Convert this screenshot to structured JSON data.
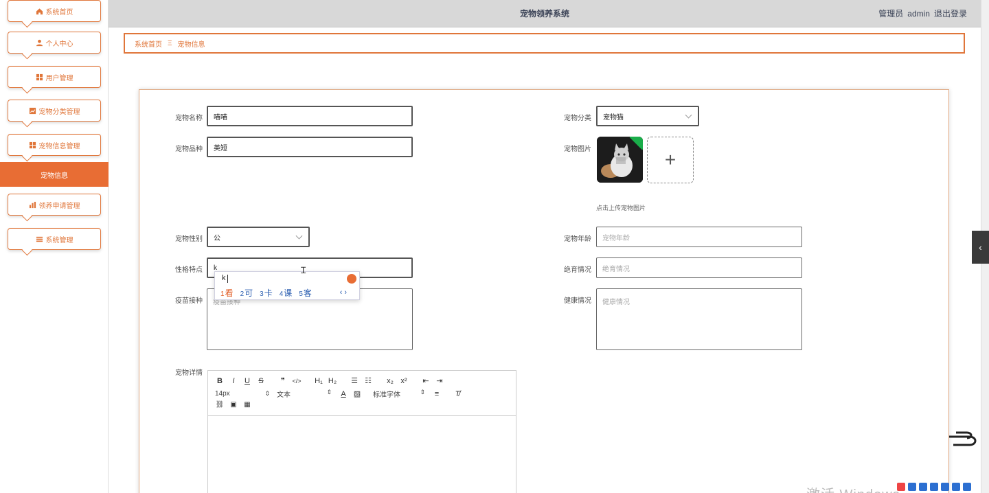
{
  "header": {
    "title": "宠物领养系统",
    "user_role": "管理员",
    "user_name": "admin",
    "logout": "退出登录"
  },
  "sidebar": {
    "items": [
      {
        "label": "系统首页",
        "icon": "home-icon"
      },
      {
        "label": "个人中心",
        "icon": "user-icon"
      },
      {
        "label": "用户管理",
        "icon": "grid-icon"
      },
      {
        "label": "宠物分类管理",
        "icon": "chart-icon"
      },
      {
        "label": "宠物信息管理",
        "icon": "grid-icon"
      },
      {
        "label": "领养申请管理",
        "icon": "bar-chart-icon"
      },
      {
        "label": "系统管理",
        "icon": "list-icon"
      }
    ],
    "active_sub": "宠物信息"
  },
  "breadcrumb": {
    "home": "系统首页",
    "sep": "Ξ",
    "current": "宠物信息"
  },
  "form": {
    "pet_name": {
      "label": "宠物名称",
      "value": "喵喵"
    },
    "pet_category": {
      "label": "宠物分类",
      "value": "宠物猫"
    },
    "pet_breed": {
      "label": "宠物品种",
      "value": "英短"
    },
    "pet_image": {
      "label": "宠物图片",
      "hint": "点击上传宠物图片",
      "add": "+"
    },
    "pet_gender": {
      "label": "宠物性别",
      "value": "公"
    },
    "pet_age": {
      "label": "宠物年龄",
      "placeholder": "宠物年龄"
    },
    "personality": {
      "label": "性格特点",
      "value": "k"
    },
    "sterilization": {
      "label": "绝育情况",
      "placeholder": "绝育情况"
    },
    "vaccine": {
      "label": "疫苗接种",
      "placeholder": "疫苗接种"
    },
    "health": {
      "label": "健康情况",
      "placeholder": "健康情况"
    },
    "details": {
      "label": "宠物详情"
    }
  },
  "editor": {
    "row1": [
      "B",
      "I",
      "U",
      "S",
      "❞",
      "</>",
      "H₁",
      "H₂",
      "☰",
      "☷",
      "x₂",
      "x²",
      "⇤",
      "⇥"
    ],
    "font_size": "14px",
    "text_type": "文本",
    "font_family": "标准字体",
    "row3": [
      "🔗",
      "🖼",
      "🎞"
    ]
  },
  "ime": {
    "input": "k",
    "candidates": [
      {
        "n": "1",
        "w": "看"
      },
      {
        "n": "2",
        "w": "可"
      },
      {
        "n": "3",
        "w": "卡"
      },
      {
        "n": "4",
        "w": "课"
      },
      {
        "n": "5",
        "w": "客"
      }
    ],
    "nav": "‹ ›"
  },
  "system": {
    "watermark": "激活 Windows",
    "side_tab": "‹"
  },
  "colors": {
    "accent": "#e0763a",
    "active_bg": "#e86d34",
    "header_bg": "#d8d8d8"
  }
}
